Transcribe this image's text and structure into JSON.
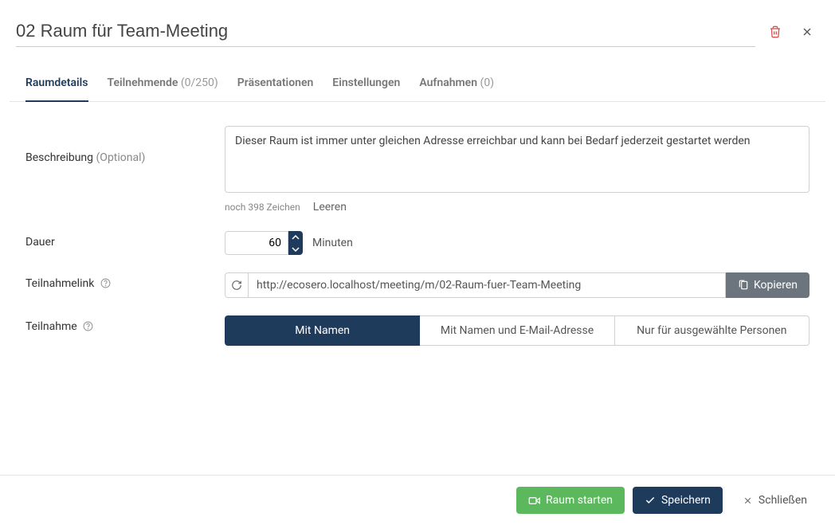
{
  "title": "02 Raum für Team-Meeting",
  "tabs": [
    {
      "label": "Raumdetails"
    },
    {
      "label": "Teilnehmende",
      "count": "(0/250)"
    },
    {
      "label": "Präsentationen"
    },
    {
      "label": "Einstellungen"
    },
    {
      "label": "Aufnahmen",
      "count": "(0)"
    }
  ],
  "description": {
    "label": "Beschreibung",
    "optional": "(Optional)",
    "value": "Dieser Raum ist immer unter gleichen Adresse erreichbar und kann bei Bedarf jederzeit gestartet werden",
    "remaining": "noch 398 Zeichen",
    "clear": "Leeren"
  },
  "duration": {
    "label": "Dauer",
    "value": "60",
    "unit": "Minuten"
  },
  "link": {
    "label": "Teilnahmelink",
    "value": "http://ecosero.localhost/meeting/m/02-Raum-fuer-Team-Meeting",
    "copy": "Kopieren"
  },
  "participation": {
    "label": "Teilnahme",
    "options": [
      "Mit Namen",
      "Mit Namen und E-Mail-Adresse",
      "Nur für ausgewählte Personen"
    ]
  },
  "footer": {
    "start": "Raum starten",
    "save": "Speichern",
    "close": "Schließen"
  }
}
